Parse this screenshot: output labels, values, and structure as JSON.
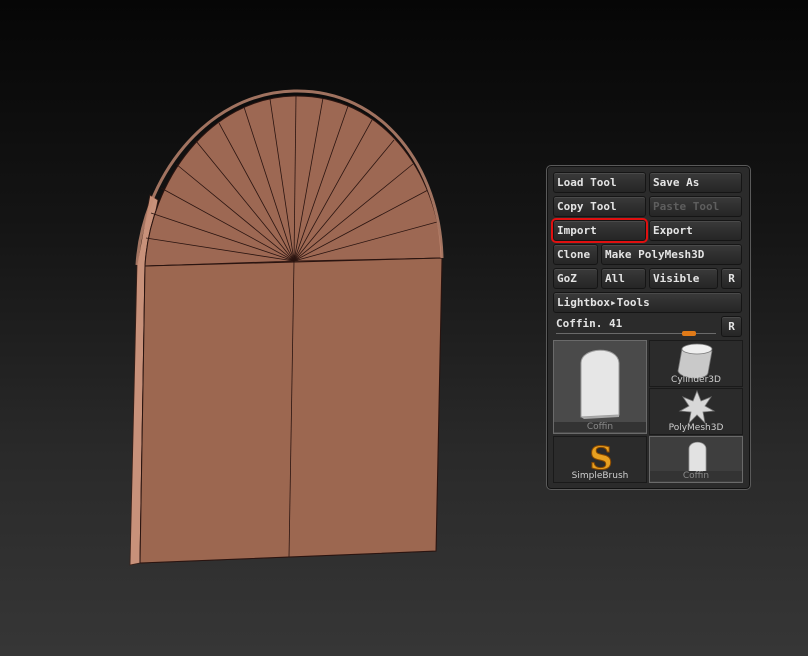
{
  "tool_panel": {
    "buttons": {
      "load_tool": "Load Tool",
      "save_as": "Save As",
      "copy_tool": "Copy Tool",
      "paste_tool": "Paste Tool",
      "import": "Import",
      "export": "Export",
      "clone": "Clone",
      "make_polymesh3d": "Make PolyMesh3D",
      "goz": "GoZ",
      "all": "All",
      "visible": "Visible",
      "r": "R",
      "lightbox_tools": "Lightbox▸Tools"
    },
    "slider": {
      "label": "Coffin. 41",
      "reset": "R",
      "value_fraction": 0.83
    },
    "thumbnails": [
      {
        "label": "Coffin",
        "selected": true
      },
      {
        "label": "Cylinder3D"
      },
      {
        "label": "PolyMesh3D"
      },
      {
        "label": "SimpleBrush"
      },
      {
        "label": "Coffin"
      }
    ]
  },
  "colors": {
    "mesh": "#9c6750",
    "accent_orange": "#e07a18",
    "highlight_red": "#e01010"
  }
}
